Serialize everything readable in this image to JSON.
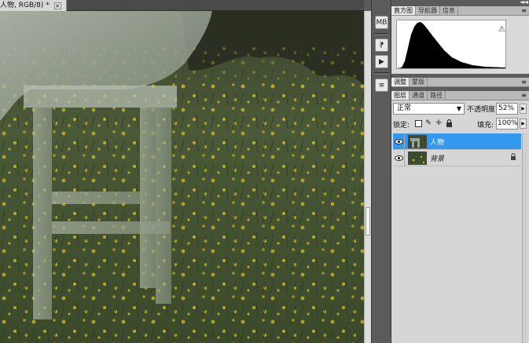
{
  "document": {
    "tab_title": "人物, RGB/8) *",
    "close_glyph": "×"
  },
  "dock": {
    "icons": [
      "histogram-panel-icon",
      "brush-preset-icon",
      "actions-icon",
      "layers-panel-icon"
    ],
    "icon_labels": [
      "MB",
      "⁋",
      "▶",
      "≡"
    ]
  },
  "panels_top": {
    "arrows": "◄◄"
  },
  "histogram_panel": {
    "tabs": [
      {
        "label": "直方图",
        "active": true
      },
      {
        "label": "导航器",
        "active": false
      },
      {
        "label": "信息",
        "active": false
      }
    ],
    "menu_glyph": "≡",
    "warning_glyph": "⚠"
  },
  "adjust_panel": {
    "tabs": [
      {
        "label": "调整",
        "active": true
      },
      {
        "label": "蒙版",
        "active": false
      }
    ],
    "menu_glyph": "≡"
  },
  "layers_panel": {
    "tabs": [
      {
        "label": "图层",
        "active": true
      },
      {
        "label": "通道",
        "active": false
      },
      {
        "label": "路径",
        "active": false
      }
    ],
    "menu_glyph": "≡",
    "blend_mode": "正常",
    "opacity_label": "不透明度:",
    "opacity_value": "52%",
    "lock_label": "锁定:",
    "fill_label": "填充:",
    "fill_value": "100%",
    "layers": [
      {
        "name": "人物",
        "selected": true,
        "locked": false
      },
      {
        "name": "背景",
        "selected": false,
        "locked": true
      }
    ]
  },
  "colors": {
    "selection": "#3399ee",
    "panel_bg": "#d6d6d6",
    "dark_ui": "#5b5b5b"
  }
}
